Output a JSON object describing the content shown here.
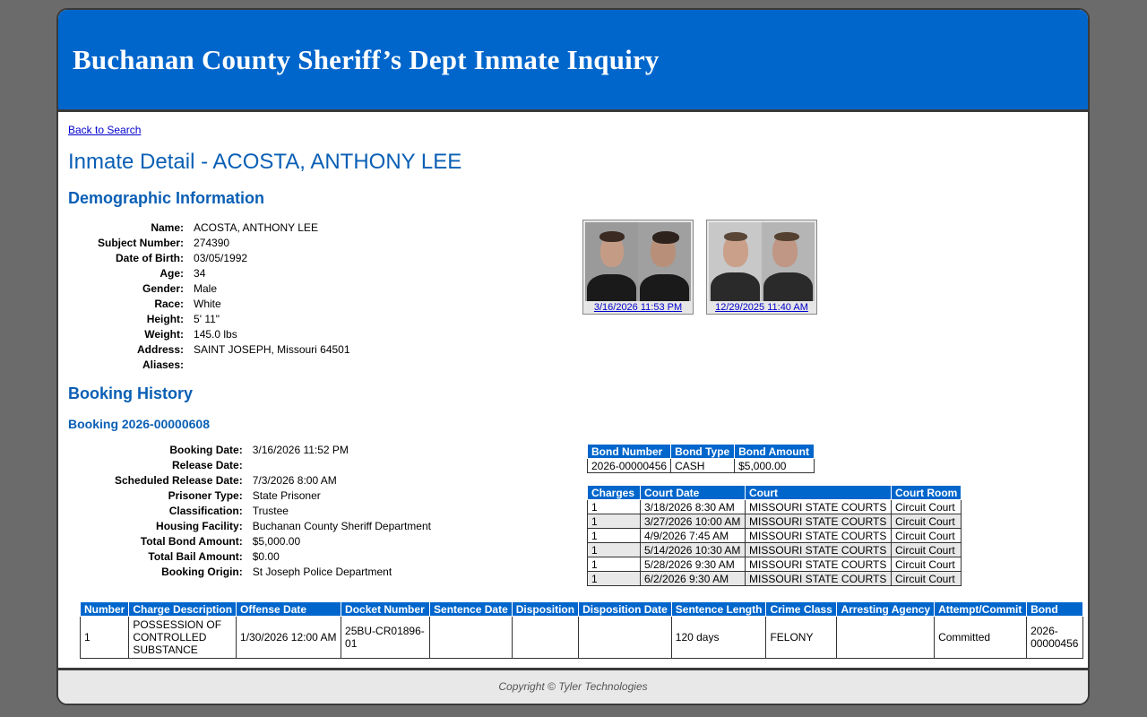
{
  "header": {
    "title": "Buchanan County Sheriff’s Dept Inmate Inquiry"
  },
  "nav": {
    "back_label": "Back to Search"
  },
  "page": {
    "title": "Inmate Detail - ACOSTA, ANTHONY LEE"
  },
  "demographics": {
    "section_title": "Demographic Information",
    "fields": [
      {
        "label": "Name:",
        "value": "ACOSTA, ANTHONY LEE"
      },
      {
        "label": "Subject Number:",
        "value": "274390"
      },
      {
        "label": "Date of Birth:",
        "value": "03/05/1992"
      },
      {
        "label": "Age:",
        "value": "34"
      },
      {
        "label": "Gender:",
        "value": "Male"
      },
      {
        "label": "Race:",
        "value": "White"
      },
      {
        "label": "Height:",
        "value": "5' 11\""
      },
      {
        "label": "Weight:",
        "value": "145.0 lbs"
      },
      {
        "label": "Address:",
        "value": "SAINT JOSEPH, Missouri 64501"
      },
      {
        "label": "Aliases:",
        "value": ""
      }
    ],
    "photos": [
      {
        "caption": "3/16/2026 11:53 PM"
      },
      {
        "caption": "12/29/2025 11:40 AM"
      }
    ]
  },
  "booking_history": {
    "section_title": "Booking History",
    "booking_title": "Booking 2026-00000608",
    "fields": [
      {
        "label": "Booking Date:",
        "value": "3/16/2026 11:52 PM"
      },
      {
        "label": "Release Date:",
        "value": ""
      },
      {
        "label": "Scheduled Release Date:",
        "value": "7/3/2026 8:00 AM"
      },
      {
        "label": "Prisoner Type:",
        "value": "State Prisoner"
      },
      {
        "label": "Classification:",
        "value": "Trustee"
      },
      {
        "label": "Housing Facility:",
        "value": "Buchanan County Sheriff Department"
      },
      {
        "label": "Total Bond Amount:",
        "value": "$5,000.00"
      },
      {
        "label": "Total Bail Amount:",
        "value": "$0.00"
      },
      {
        "label": "Booking Origin:",
        "value": "St Joseph Police Department"
      }
    ],
    "bonds": {
      "headers": [
        "Bond Number",
        "Bond Type",
        "Bond Amount"
      ],
      "rows": [
        [
          "2026-00000456",
          "CASH",
          "$5,000.00"
        ]
      ]
    },
    "court": {
      "headers": [
        "Charges",
        "Court Date",
        "Court",
        "Court Room"
      ],
      "rows": [
        [
          "1",
          "3/18/2026 8:30 AM",
          "MISSOURI STATE COURTS",
          "Circuit Court"
        ],
        [
          "1",
          "3/27/2026 10:00 AM",
          "MISSOURI STATE COURTS",
          "Circuit Court"
        ],
        [
          "1",
          "4/9/2026 7:45 AM",
          "MISSOURI STATE COURTS",
          "Circuit Court"
        ],
        [
          "1",
          "5/14/2026 10:30 AM",
          "MISSOURI STATE COURTS",
          "Circuit Court"
        ],
        [
          "1",
          "5/28/2026 9:30 AM",
          "MISSOURI STATE COURTS",
          "Circuit Court"
        ],
        [
          "1",
          "6/2/2026 9:30 AM",
          "MISSOURI STATE COURTS",
          "Circuit Court"
        ]
      ]
    },
    "charges": {
      "headers": [
        "Number",
        "Charge Description",
        "Offense Date",
        "Docket Number",
        "Sentence Date",
        "Disposition",
        "Disposition Date",
        "Sentence Length",
        "Crime Class",
        "Arresting Agency",
        "Attempt/Commit",
        "Bond"
      ],
      "rows": [
        [
          "1",
          "POSSESSION OF CONTROLLED SUBSTANCE",
          "1/30/2026 12:00 AM",
          "25BU-CR01896-01",
          "",
          "",
          "",
          "120 days",
          "FELONY",
          "",
          "Committed",
          "2026-00000456"
        ]
      ]
    }
  },
  "footer": {
    "copyright": "Copyright © Tyler Technologies"
  }
}
